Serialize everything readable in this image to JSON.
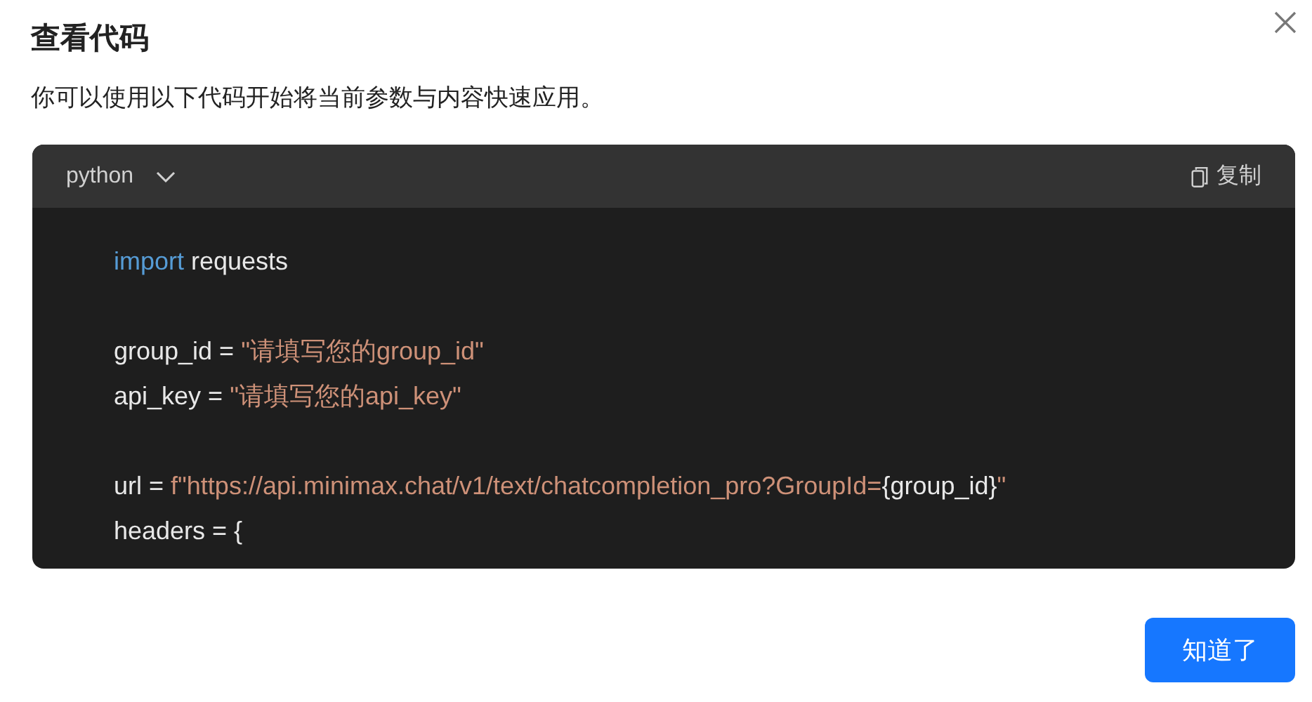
{
  "dialog": {
    "title": "查看代码",
    "description": "你可以使用以下代码开始将当前参数与内容快速应用。"
  },
  "code": {
    "language": "python",
    "copy_label": "复制",
    "groups": [
      [
        [
          {
            "kind": "keyword",
            "text": "import"
          },
          {
            "kind": "plain",
            "text": " requests"
          }
        ]
      ],
      [
        [
          {
            "kind": "plain",
            "text": "group_id = "
          },
          {
            "kind": "string",
            "text": "\"请填写您的group_id\""
          }
        ],
        [
          {
            "kind": "plain",
            "text": "api_key = "
          },
          {
            "kind": "string",
            "text": "\"请填写您的api_key\""
          }
        ]
      ],
      [
        [
          {
            "kind": "plain",
            "text": "url = "
          },
          {
            "kind": "string",
            "text": "f\"https://api.minimax.chat/v1/text/chatcompletion_pro?GroupId="
          },
          {
            "kind": "plain",
            "text": "{group_id}"
          },
          {
            "kind": "string",
            "text": "\""
          }
        ],
        [
          {
            "kind": "plain",
            "text": "headers = {"
          }
        ]
      ]
    ]
  },
  "buttons": [
    {
      "label": "知道了"
    }
  ]
}
